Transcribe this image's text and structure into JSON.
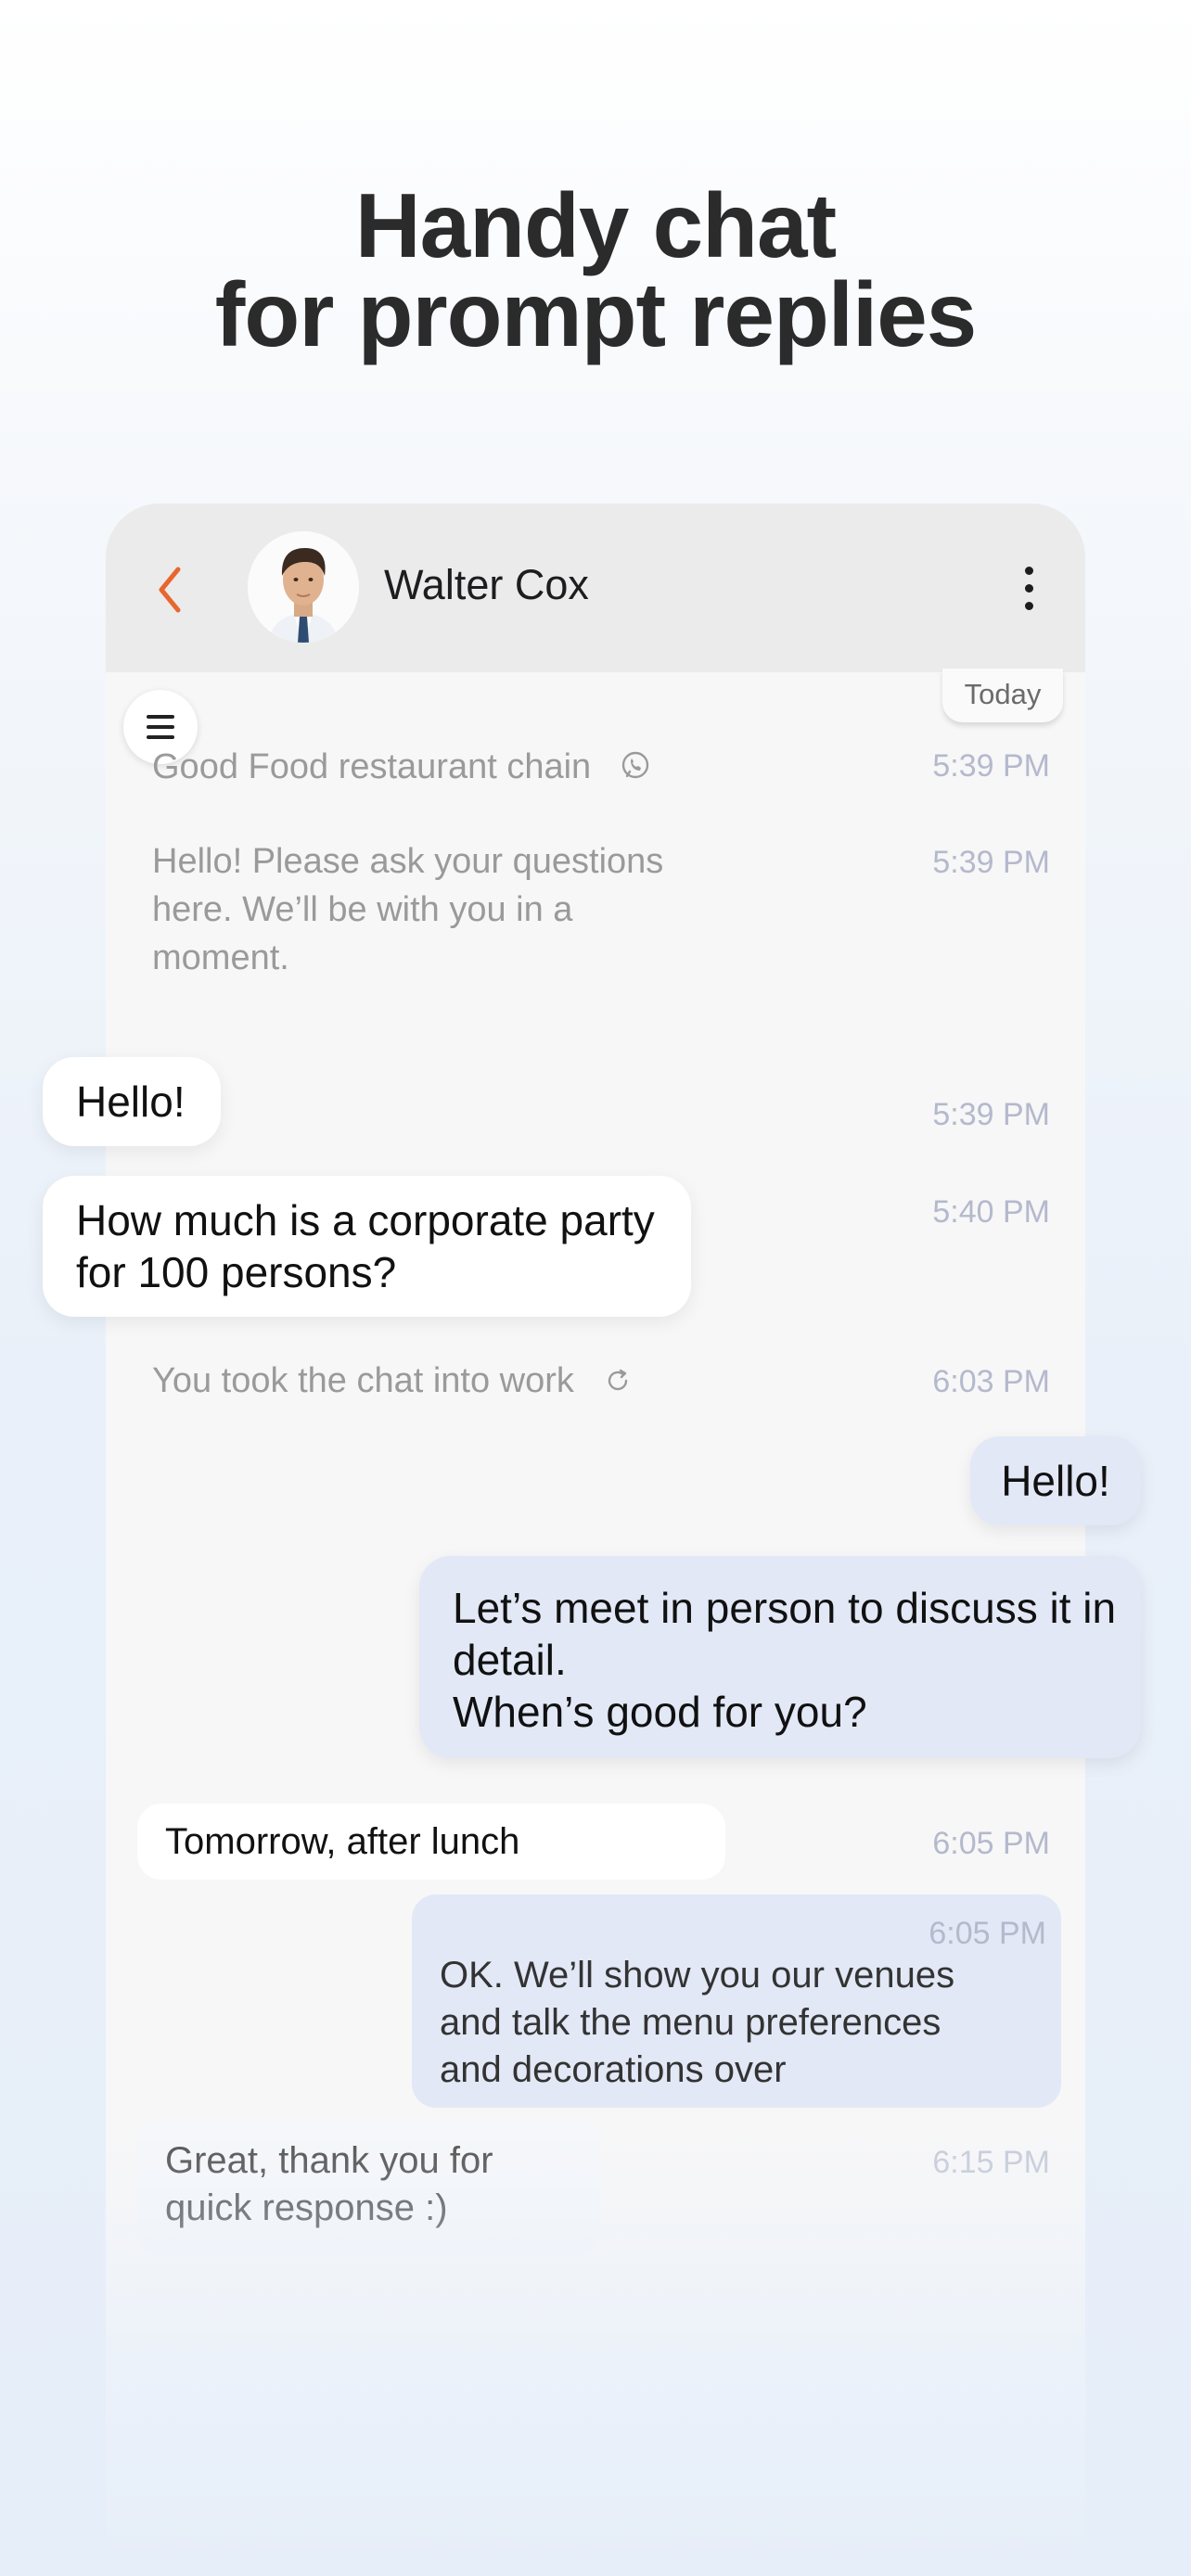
{
  "headline": {
    "line1": "Handy chat",
    "line2": "for prompt replies"
  },
  "header": {
    "contact_name": "Walter Cox"
  },
  "chat": {
    "date_chip": "Today",
    "messages": [
      {
        "text": "Good Food restaurant chain",
        "time": "5:39 PM"
      },
      {
        "text": "Hello! Please ask your questions here. We’ll be with you in a moment.",
        "time": "5:39 PM"
      },
      {
        "text": "Hello!",
        "time": "5:39 PM"
      },
      {
        "text": "How much is a corporate party for 100 persons?",
        "time": "5:40 PM"
      },
      {
        "text": "You took the chat into work",
        "time": "6:03 PM"
      },
      {
        "text": "Hello!"
      },
      {
        "text": "Let’s meet in person to discuss it in detail.\nWhen’s good for you?"
      },
      {
        "text": "Tomorrow, after lunch",
        "time": "6:05 PM"
      },
      {
        "text": "OK. We’ll show you our venues and talk the menu preferences and decorations over",
        "time": "6:05 PM"
      },
      {
        "text": "Great, thank you for quick response :)",
        "time": "6:15 PM"
      }
    ]
  },
  "icons": {
    "back": "chevron-left-icon",
    "more": "more-vertical-icon",
    "menu": "hamburger-icon",
    "channel": "viber-icon",
    "status": "refresh-icon"
  },
  "colors": {
    "accent": "#e8662f",
    "outgoing_bubble": "#e2e8f6",
    "header_bg": "#ebebeb",
    "time_text": "#b4b9cc"
  }
}
